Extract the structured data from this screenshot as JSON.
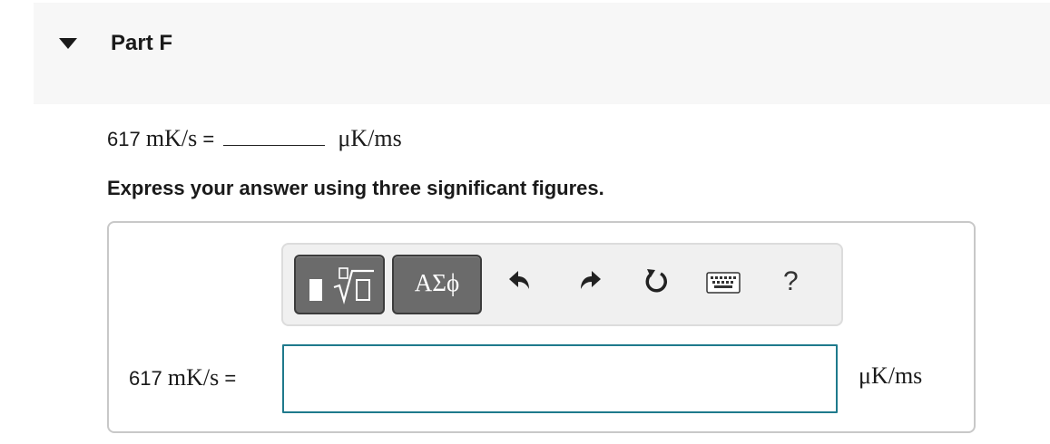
{
  "part": {
    "title": "Part F",
    "toggle_icon": "triangle-down-icon"
  },
  "question": {
    "lhs_value": "617",
    "lhs_unit": "mK/s",
    "equals": "=",
    "rhs_unit": "μK/ms"
  },
  "instruction": "Express your answer using three significant figures.",
  "toolbar": {
    "templates_icon": "templates-icon",
    "greek_label": "ΑΣϕ",
    "undo_icon": "undo-icon",
    "redo_icon": "redo-icon",
    "reset_icon": "reset-icon",
    "keyboard_icon": "keyboard-icon",
    "help_label": "?"
  },
  "answer": {
    "prefix_value": "617",
    "prefix_unit": "mK/s",
    "equals": "=",
    "input_value": "",
    "unit": "μK/ms"
  },
  "colors": {
    "header_bg": "#f7f7f7",
    "toolbar_button": "#6b6b6b",
    "input_border": "#1f7a8c"
  }
}
